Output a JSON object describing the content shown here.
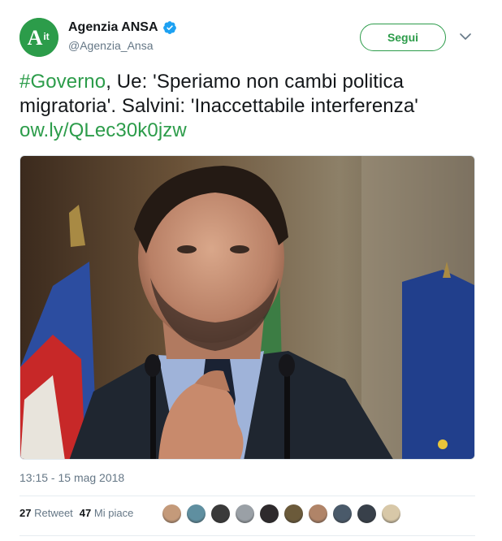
{
  "account": {
    "display_name": "Agenzia ANSA",
    "handle": "@Agenzia_Ansa",
    "avatar_text": "A",
    "avatar_superscript": "it",
    "verified": true
  },
  "follow_label": "Segui",
  "tweet": {
    "hashtag": "#Governo",
    "text": ", Ue: 'Speriamo non cambi politica migratoria'. Salvini: 'Inaccettabile interferenza' ",
    "link": "ow.ly/QLec30k0jzw"
  },
  "timestamp": "13:15 - 15 mag 2018",
  "stats": {
    "retweets_count": "27",
    "retweets_label": "Retweet",
    "likes_count": "47",
    "likes_label": "Mi piace"
  },
  "colors": {
    "accent": "#2c9c4a",
    "verified": "#1da1f2",
    "secondary_text": "#657786"
  },
  "likers": [
    {
      "color": "#c49a7a"
    },
    {
      "color": "#5f8fa0"
    },
    {
      "color": "#3a3a3a"
    },
    {
      "color": "#9aa0a6"
    },
    {
      "color": "#2e2a2c"
    },
    {
      "color": "#6b5a3a"
    },
    {
      "color": "#b08468"
    },
    {
      "color": "#4a5a6a"
    },
    {
      "color": "#38404a"
    },
    {
      "color": "#d8c8a8"
    }
  ]
}
